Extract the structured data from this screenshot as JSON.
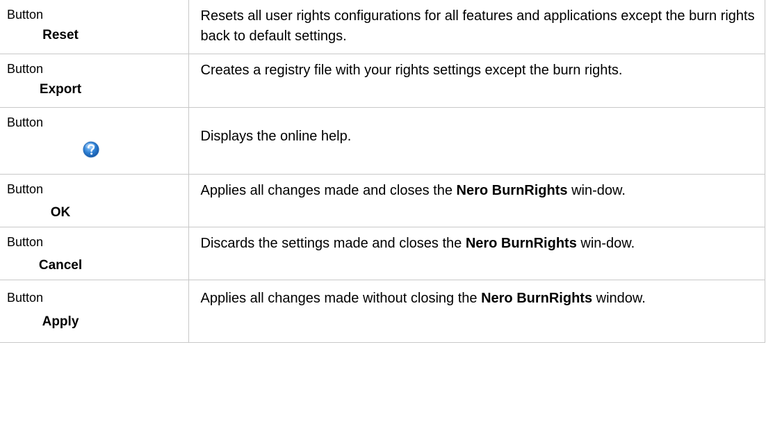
{
  "rows": [
    {
      "type": "Button",
      "name": "Reset",
      "desc": "Resets all user rights configurations for all features and applications except the burn rights back to default settings."
    },
    {
      "type": "Button",
      "name": "Export",
      "desc": "Creates a registry file with your rights settings except the burn rights."
    },
    {
      "type": "Button",
      "icon": "help-question-icon",
      "desc": "Displays the online help."
    },
    {
      "type": "Button",
      "name": "OK",
      "desc_pre": "Applies all changes made and closes the ",
      "desc_bold": "Nero BurnRights",
      "desc_post": " win-dow."
    },
    {
      "type": "Button",
      "name": "Cancel",
      "desc_pre": "Discards the settings made and closes the ",
      "desc_bold": "Nero BurnRights",
      "desc_post": " win-dow."
    },
    {
      "type": "Button",
      "name": "Apply",
      "desc_pre": "Applies all changes made without closing the ",
      "desc_bold": "Nero BurnRights",
      "desc_post": " window."
    }
  ],
  "colors": {
    "border": "#c8c8c8",
    "icon_blue": "#2d7fd3"
  }
}
